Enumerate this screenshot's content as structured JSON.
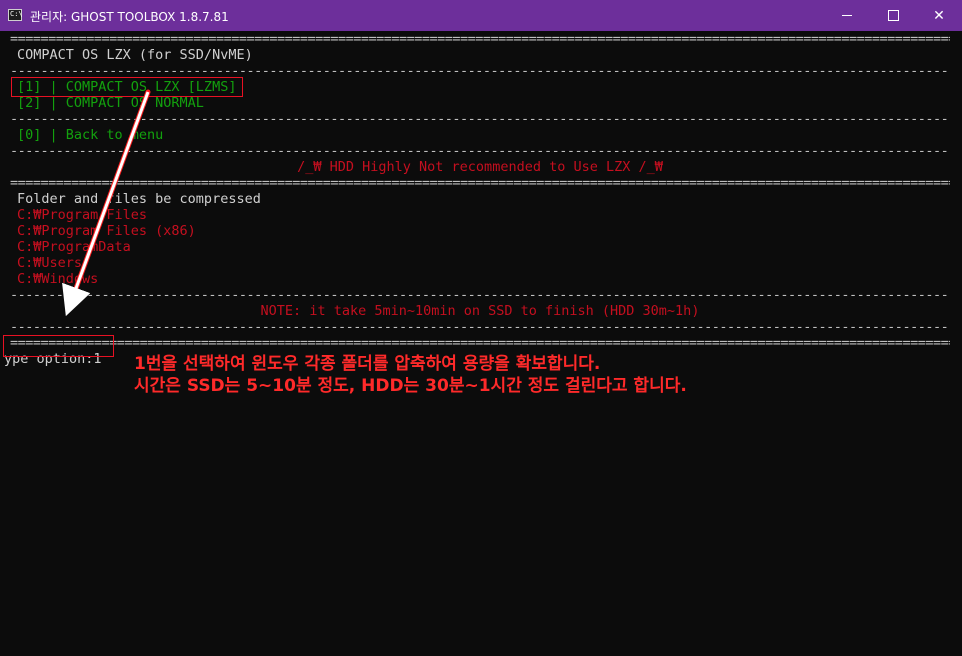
{
  "window": {
    "title": "관리자:  GHOST TOOLBOX 1.8.7.81",
    "icon_label": "C:\\",
    "buttons": {
      "minimize": "minimize-icon",
      "maximize": "maximize-icon",
      "close": "✕"
    }
  },
  "console": {
    "separator_double": "=================================================================================================================================",
    "separator_single": "---------------------------------------------------------------------------------------------------------------------------------",
    "heading": "COMPACT OS LZX (for SSD/NvME)",
    "options": [
      {
        "label": "[1] | COMPACT OS LZX [LZMS]"
      },
      {
        "label": "[2] | COMPACT OS NORMAL"
      }
    ],
    "back": "[0] | Back to menu",
    "warning": "/_₩ HDD Highly Not recommended to Use LZX /_₩",
    "folders_title": "Folder and files be compressed",
    "folders": [
      "C:₩Program Files",
      "C:₩Program Files (x86)",
      "C:₩ProgramData",
      "C:₩Users",
      "C:₩Windows"
    ],
    "note": "NOTE: it take 5min~10min on SSD to finish (HDD 30m~1h)",
    "prompt": "ype option:1"
  },
  "annotation": {
    "line1": "1번을 선택하여 윈도우 각종 폴더를 압축하여 용량을 확보합니다.",
    "line2": "시간은 SSD는 5~10분 정도, HDD는 30분~1시간 정도 걸린다고 합니다.",
    "color": "#ff2a2a"
  }
}
